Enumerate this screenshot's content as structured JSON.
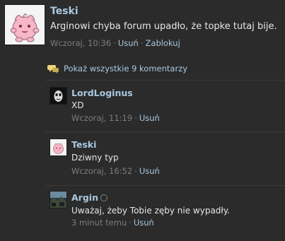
{
  "post": {
    "author": "Teski",
    "text": "Arginowi chyba forum upadło, że topke tutaj bije.",
    "time": "Wczoraj, 10:36",
    "delete_label": "Usuń",
    "block_label": "Zablokuj"
  },
  "show_all": {
    "label": "Pokaż wszystkie 9 komentarzy",
    "icon": "speech-bubbles-icon"
  },
  "comments": [
    {
      "author": "LordLoginus",
      "text": "XD",
      "time": "Wczoraj, 11:19",
      "delete_label": "Usuń",
      "avatar": "dark-mask-avatar"
    },
    {
      "author": "Teski",
      "text": "Dziwny typ",
      "time": "Wczoraj, 16:52",
      "delete_label": "Usuń",
      "avatar": "pink-creature-avatar"
    },
    {
      "author": "Argin",
      "text": "Uważaj, żeby Tobie zęby nie wypadły.",
      "time": "3 minut temu",
      "delete_label": "Usuń",
      "avatar": "landscape-avatar"
    }
  ],
  "colors": {
    "background": "#2b2b2b",
    "link": "#a9c8e0",
    "meta": "#7d7d7d",
    "text": "#e6e6e6"
  }
}
